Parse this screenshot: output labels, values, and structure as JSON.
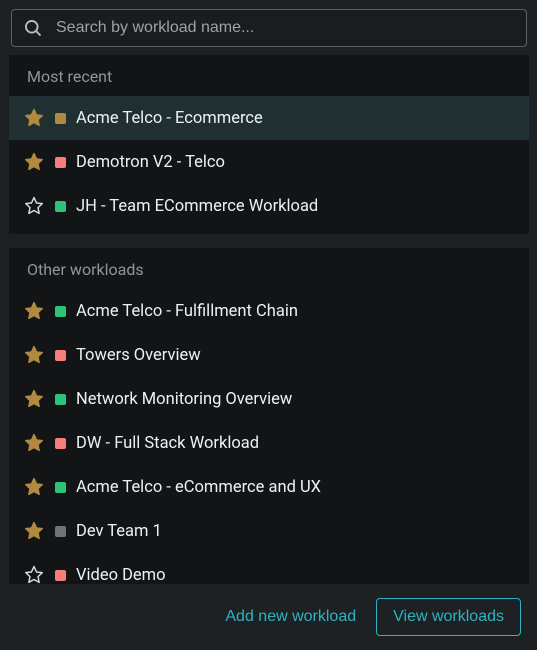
{
  "search": {
    "placeholder": "Search by workload name..."
  },
  "sections": {
    "recent": {
      "label": "Most recent",
      "items": [
        {
          "name": "Acme Telco - Ecommerce",
          "color": "#b1893f",
          "starred": true,
          "selected": true
        },
        {
          "name": "Demotron V2 - Telco",
          "color": "#f77d7d",
          "starred": true,
          "selected": false
        },
        {
          "name": "JH - Team ECommerce Workload",
          "color": "#2fc27a",
          "starred": false,
          "selected": false
        }
      ]
    },
    "other": {
      "label": "Other workloads",
      "items": [
        {
          "name": "Acme Telco - Fulfillment Chain",
          "color": "#2fc27a",
          "starred": true,
          "selected": false
        },
        {
          "name": "Towers Overview",
          "color": "#f77d7d",
          "starred": true,
          "selected": false
        },
        {
          "name": "Network Monitoring Overview",
          "color": "#2fc27a",
          "starred": true,
          "selected": false
        },
        {
          "name": "DW - Full Stack Workload",
          "color": "#f77d7d",
          "starred": true,
          "selected": false
        },
        {
          "name": "Acme Telco - eCommerce and UX",
          "color": "#2fc27a",
          "starred": true,
          "selected": false
        },
        {
          "name": "Dev Team 1",
          "color": "#6d747a",
          "starred": true,
          "selected": false
        },
        {
          "name": "Video Demo",
          "color": "#f77d7d",
          "starred": false,
          "selected": false
        }
      ]
    }
  },
  "footer": {
    "add_label": "Add new workload",
    "view_label": "View workloads"
  }
}
